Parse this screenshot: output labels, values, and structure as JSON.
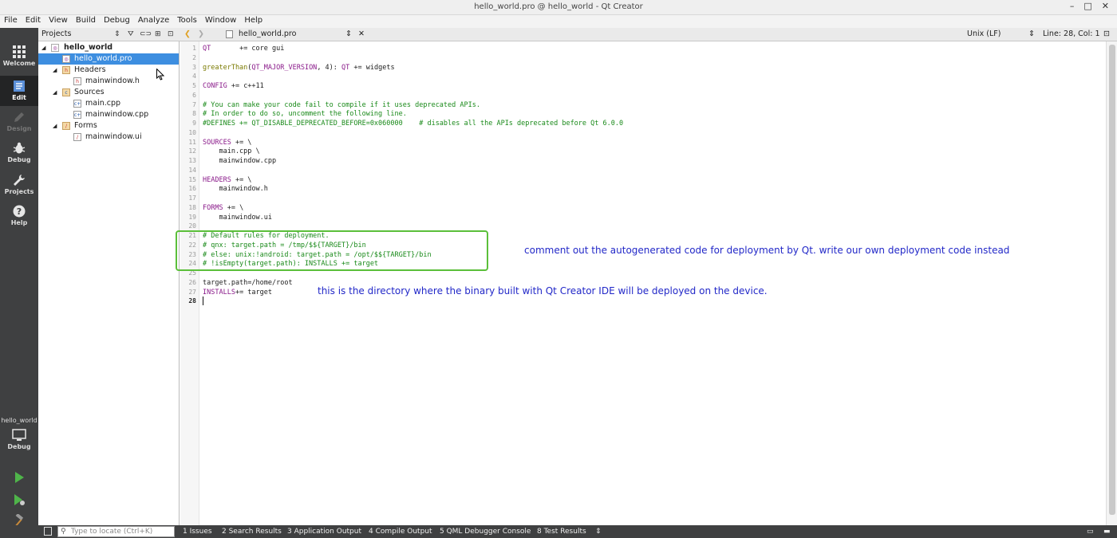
{
  "window": {
    "title": "hello_world.pro @ hello_world - Qt Creator",
    "controls": [
      "–",
      "□",
      "✕"
    ]
  },
  "menu": [
    "File",
    "Edit",
    "View",
    "Build",
    "Debug",
    "Analyze",
    "Tools",
    "Window",
    "Help"
  ],
  "modes": [
    {
      "label": "Welcome",
      "icon": "grid-icon"
    },
    {
      "label": "Edit",
      "icon": "edit-icon",
      "active": true
    },
    {
      "label": "Design",
      "icon": "pencil-icon",
      "disabled": true
    },
    {
      "label": "Debug",
      "icon": "bug-icon"
    },
    {
      "label": "Projects",
      "icon": "wrench-icon"
    },
    {
      "label": "Help",
      "icon": "question-icon"
    }
  ],
  "kit": {
    "name": "hello_world",
    "build": "Debug"
  },
  "projects_pane": {
    "label": "Projects",
    "tree": [
      {
        "name": "hello_world",
        "kind": "project",
        "bold": true
      },
      {
        "name": "hello_world.pro",
        "kind": "pro",
        "selected": true
      },
      {
        "name": "Headers",
        "kind": "folder"
      },
      {
        "name": "mainwindow.h",
        "kind": "h"
      },
      {
        "name": "Sources",
        "kind": "folder"
      },
      {
        "name": "main.cpp",
        "kind": "cpp"
      },
      {
        "name": "mainwindow.cpp",
        "kind": "cpp"
      },
      {
        "name": "Forms",
        "kind": "folder"
      },
      {
        "name": "mainwindow.ui",
        "kind": "ui"
      }
    ]
  },
  "editor_toolbar": {
    "file": "hello_world.pro",
    "line_ending": "Unix (LF)",
    "position": "Line: 28, Col: 1"
  },
  "code": [
    "QT       += core gui",
    "",
    "greaterThan(QT_MAJOR_VERSION, 4): QT += widgets",
    "",
    "CONFIG += c++11",
    "",
    "# You can make your code fail to compile if it uses deprecated APIs.",
    "# In order to do so, uncomment the following line.",
    "#DEFINES += QT_DISABLE_DEPRECATED_BEFORE=0x060000    # disables all the APIs deprecated before Qt 6.0.0",
    "",
    "SOURCES += \\",
    "    main.cpp \\",
    "    mainwindow.cpp",
    "",
    "HEADERS += \\",
    "    mainwindow.h",
    "",
    "FORMS += \\",
    "    mainwindow.ui",
    "",
    "# Default rules for deployment.",
    "# qnx: target.path = /tmp/$${TARGET}/bin",
    "# else: unix:!android: target.path = /opt/$${TARGET}/bin",
    "# !isEmpty(target.path): INSTALLS += target",
    "",
    "target.path=/home/root",
    "INSTALLS+= target",
    ""
  ],
  "annotations": {
    "deployment_note": "comment out the autogenerated code for deployment by Qt. write our own deployment code instead",
    "directory_note": "this is the directory where the binary built with Qt Creator IDE will be deployed on the device."
  },
  "statusbar": {
    "locator_placeholder": "Type to locate (Ctrl+K)",
    "panes": [
      "1  Issues",
      "2  Search Results",
      "3  Application Output",
      "4  Compile Output",
      "5  QML Debugger Console",
      "8  Test Results"
    ]
  }
}
